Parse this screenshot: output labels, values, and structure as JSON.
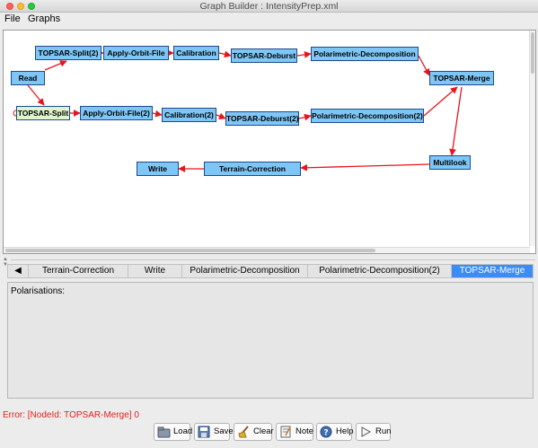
{
  "window": {
    "title": "Graph Builder : IntensityPrep.xml"
  },
  "menu": [
    "File",
    "Graphs"
  ],
  "graph": {
    "nodes": [
      {
        "id": "read",
        "label": "Read"
      },
      {
        "id": "split2",
        "label": "TOPSAR-Split(2)"
      },
      {
        "id": "orbit",
        "label": "Apply-Orbit-File"
      },
      {
        "id": "calib",
        "label": "Calibration"
      },
      {
        "id": "deburst",
        "label": "TOPSAR-Deburst"
      },
      {
        "id": "polar",
        "label": "Polarimetric-Decomposition"
      },
      {
        "id": "merge",
        "label": "TOPSAR-Merge"
      },
      {
        "id": "split",
        "label": "TOPSAR-Split"
      },
      {
        "id": "orbit2",
        "label": "Apply-Orbit-File(2)"
      },
      {
        "id": "calib2",
        "label": "Calibration(2)"
      },
      {
        "id": "deburst2",
        "label": "TOPSAR-Deburst(2)"
      },
      {
        "id": "polar2",
        "label": "Polarimetric-Decomposition(2)"
      },
      {
        "id": "multilook",
        "label": "Multilook"
      },
      {
        "id": "terrain",
        "label": "Terrain-Correction"
      },
      {
        "id": "write",
        "label": "Write"
      }
    ],
    "selected_node": "split",
    "colors": {
      "node": "#7dc6f5",
      "node_border": "#1e4a8a",
      "selected_node": "#dff5cf",
      "edge": "#e8141c"
    }
  },
  "tabs": {
    "scroll_left_icon": "left-triangle-icon",
    "items": [
      "Terrain-Correction",
      "Write",
      "Polarimetric-Decomposition",
      "Polarimetric-Decomposition(2)",
      "TOPSAR-Merge"
    ],
    "active": "TOPSAR-Merge",
    "active_color": "#3b8cf7"
  },
  "panel": {
    "polarisations_label": "Polarisations:"
  },
  "status": {
    "error": "Error: [NodeId: TOPSAR-Merge] 0",
    "error_color": "#e4201c"
  },
  "buttons": [
    {
      "label": "Load",
      "icon": "open-folder-icon"
    },
    {
      "label": "Save",
      "icon": "save-icon"
    },
    {
      "label": "Clear",
      "icon": "broom-icon"
    },
    {
      "label": "Note",
      "icon": "note-icon"
    },
    {
      "label": "Help",
      "icon": "help-icon"
    },
    {
      "label": "Run",
      "icon": "play-icon"
    }
  ]
}
